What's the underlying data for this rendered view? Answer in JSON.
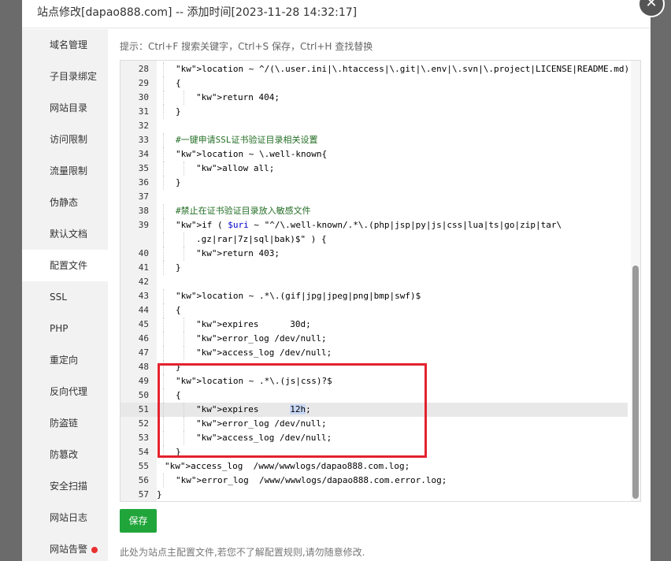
{
  "dialog": {
    "title": "站点修改[dapao888.com] -- 添加时间[2023-11-28 14:32:17]",
    "close_icon": "close-icon"
  },
  "sidebar": {
    "items": [
      {
        "label": "域名管理"
      },
      {
        "label": "子目录绑定"
      },
      {
        "label": "网站目录"
      },
      {
        "label": "访问限制"
      },
      {
        "label": "流量限制"
      },
      {
        "label": "伪静态"
      },
      {
        "label": "默认文档"
      },
      {
        "label": "配置文件",
        "active": true
      },
      {
        "label": "SSL"
      },
      {
        "label": "PHP"
      },
      {
        "label": "重定向"
      },
      {
        "label": "反向代理"
      },
      {
        "label": "防盗链"
      },
      {
        "label": "防篡改"
      },
      {
        "label": "安全扫描"
      },
      {
        "label": "网站日志"
      },
      {
        "label": "网站告警",
        "dot": true
      }
    ]
  },
  "hint": "提示：Ctrl+F 搜索关键字，Ctrl+S 保存，Ctrl+H 查找替换",
  "editor": {
    "lines": [
      {
        "n": "28",
        "t": "location ~ ^/(\\.user.ini|\\.htaccess|\\.git|\\.env|\\.svn|\\.project|LICENSE|README.md)"
      },
      {
        "n": "29",
        "t": "{"
      },
      {
        "n": "30",
        "t": "return 404;"
      },
      {
        "n": "31",
        "t": "}"
      },
      {
        "n": "32",
        "t": ""
      },
      {
        "n": "33",
        "t": "#一键申请SSL证书验证目录相关设置"
      },
      {
        "n": "34",
        "t": "location ~ \\.well-known{"
      },
      {
        "n": "35",
        "t": "allow all;"
      },
      {
        "n": "36",
        "t": "}"
      },
      {
        "n": "37",
        "t": ""
      },
      {
        "n": "38",
        "t": "#禁止在证书验证目录放入敏感文件"
      },
      {
        "n": "39",
        "t": "if ( $uri ~ \"^/\\.well-known/.*\\.(php|jsp|py|js|css|lua|ts|go|zip|tar\\"
      },
      {
        "n": "",
        "t": ".gz|rar|7z|sql|bak)$\" ) {"
      },
      {
        "n": "40",
        "t": "return 403;"
      },
      {
        "n": "41",
        "t": "}"
      },
      {
        "n": "42",
        "t": ""
      },
      {
        "n": "43",
        "t": "location ~ .*\\.(gif|jpg|jpeg|png|bmp|swf)$"
      },
      {
        "n": "44",
        "t": "{"
      },
      {
        "n": "45",
        "t": "expires      30d;"
      },
      {
        "n": "46",
        "t": "error_log /dev/null;"
      },
      {
        "n": "47",
        "t": "access_log /dev/null;"
      },
      {
        "n": "48",
        "t": "}"
      },
      {
        "n": "49",
        "t": "location ~ .*\\.(js|css)?$"
      },
      {
        "n": "50",
        "t": "{"
      },
      {
        "n": "51",
        "t": "expires      12h;"
      },
      {
        "n": "52",
        "t": "error_log /dev/null;"
      },
      {
        "n": "53",
        "t": "access_log /dev/null;"
      },
      {
        "n": "54",
        "t": "}"
      },
      {
        "n": "55",
        "t": "access_log  /www/wwwlogs/dapao888.com.log;"
      },
      {
        "n": "56",
        "t": "error_log  /www/wwwlogs/dapao888.com.error.log;"
      },
      {
        "n": "57",
        "t": "}"
      }
    ]
  },
  "save_label": "保存",
  "footnote": "此处为站点主配置文件,若您不了解配置规则,请勿随意修改."
}
